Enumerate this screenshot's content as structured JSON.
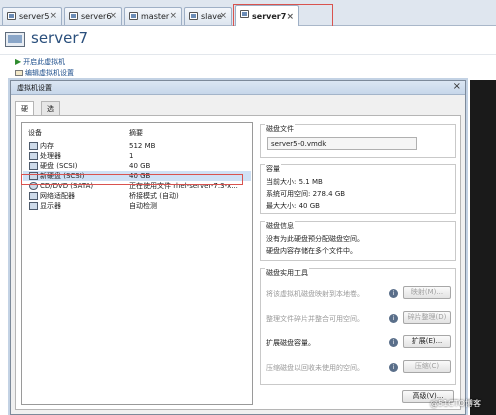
{
  "tabs": [
    {
      "label": "server5",
      "active": false
    },
    {
      "label": "server6",
      "active": false
    },
    {
      "label": "master",
      "active": false
    },
    {
      "label": "slave",
      "active": false
    },
    {
      "label": "server7",
      "active": true
    }
  ],
  "vm": {
    "title": "server7",
    "commands": {
      "start": "开启此虚拟机",
      "edit": "编辑虚拟机设置"
    }
  },
  "dialog": {
    "title": "虚拟机设置",
    "close_glyph": "×",
    "tabs": [
      "硬件",
      "选项"
    ],
    "devices_header": {
      "name": "设备",
      "summary": "摘要"
    },
    "devices": [
      {
        "name": "内存",
        "summary": "512 MB",
        "icon": "memory-icon"
      },
      {
        "name": "处理器",
        "summary": "1",
        "icon": "processor-icon"
      },
      {
        "name": "硬盘 (SCSI)",
        "summary": "40 GB",
        "icon": "hard-disk-icon"
      },
      {
        "name": "新硬盘 (SCSI)",
        "summary": "40 GB",
        "icon": "hard-disk-icon",
        "selected": true
      },
      {
        "name": "CD/DVD (SATA)",
        "summary": "正在使用文件 rhel-server-7.3-x...",
        "icon": "cd-dvd-icon"
      },
      {
        "name": "网络适配器",
        "summary": "桥接模式 (自动)",
        "icon": "network-adapter-icon"
      },
      {
        "name": "显示器",
        "summary": "自动检测",
        "icon": "display-icon"
      }
    ],
    "disk_file": {
      "title": "磁盘文件",
      "value": "server5-0.vmdk"
    },
    "capacity": {
      "title": "容量",
      "current": "当前大小: 5.1 MB",
      "available": "系统可用空间: 278.4 GB",
      "max": "最大大小: 40 GB"
    },
    "disk_info": {
      "title": "磁盘信息",
      "line1": "没有为此硬盘预分配磁盘空间。",
      "line2": "硬盘内容存储在多个文件中。"
    },
    "disk_tools": {
      "title": "磁盘实用工具",
      "map_desc": "将该虚拟机磁盘映射到本地卷。",
      "map_btn": "映射(M)...",
      "defrag_desc": "整理文件碎片并整合可用空间。",
      "defrag_btn": "碎片整理(D)",
      "expand_desc": "扩展磁盘容量。",
      "expand_btn": "扩展(E)...",
      "compact_desc": "压缩磁盘以回收未使用的空间。",
      "compact_btn": "压缩(C)"
    },
    "advanced_btn": "高级(V)..."
  },
  "watermark": "@51CTO博客"
}
